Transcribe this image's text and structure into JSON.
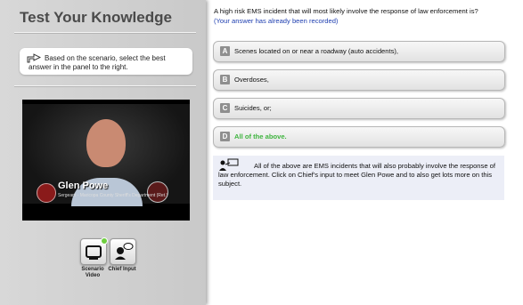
{
  "left_panel": {
    "title": "Test Your Knowledge",
    "instruction": "Based on the scenario, select the best answer in the panel to the right.",
    "video": {
      "name": "Glen Powe",
      "subtitle": "Sergeant - Maricopa County Sheriff's Department (Ret.)"
    },
    "buttons": [
      {
        "label": "Scenario Video",
        "icon": "tv-icon"
      },
      {
        "label": "Chief Input",
        "icon": "chief-speech-icon"
      }
    ]
  },
  "question": {
    "text": "A high risk EMS incident that will most likely involve the response of law enforcement is?",
    "status": "(Your answer has already been recorded)"
  },
  "options": [
    {
      "letter": "A",
      "text": "Scenes located on or near a roadway (auto accidents),"
    },
    {
      "letter": "B",
      "text": "Overdoses,"
    },
    {
      "letter": "C",
      "text": "Suicides, or;"
    },
    {
      "letter": "D",
      "text": "All of the above."
    }
  ],
  "explanation": {
    "text": "All of the above are EMS incidents that will also probably involve the response of law enforcement. Click on Chief's input to meet Glen Powe and to also get lots more on this subject."
  },
  "colors": {
    "correct": "#3fb53f",
    "recorded": "#1f3fb0",
    "explanation_bg": "#eceef7"
  }
}
